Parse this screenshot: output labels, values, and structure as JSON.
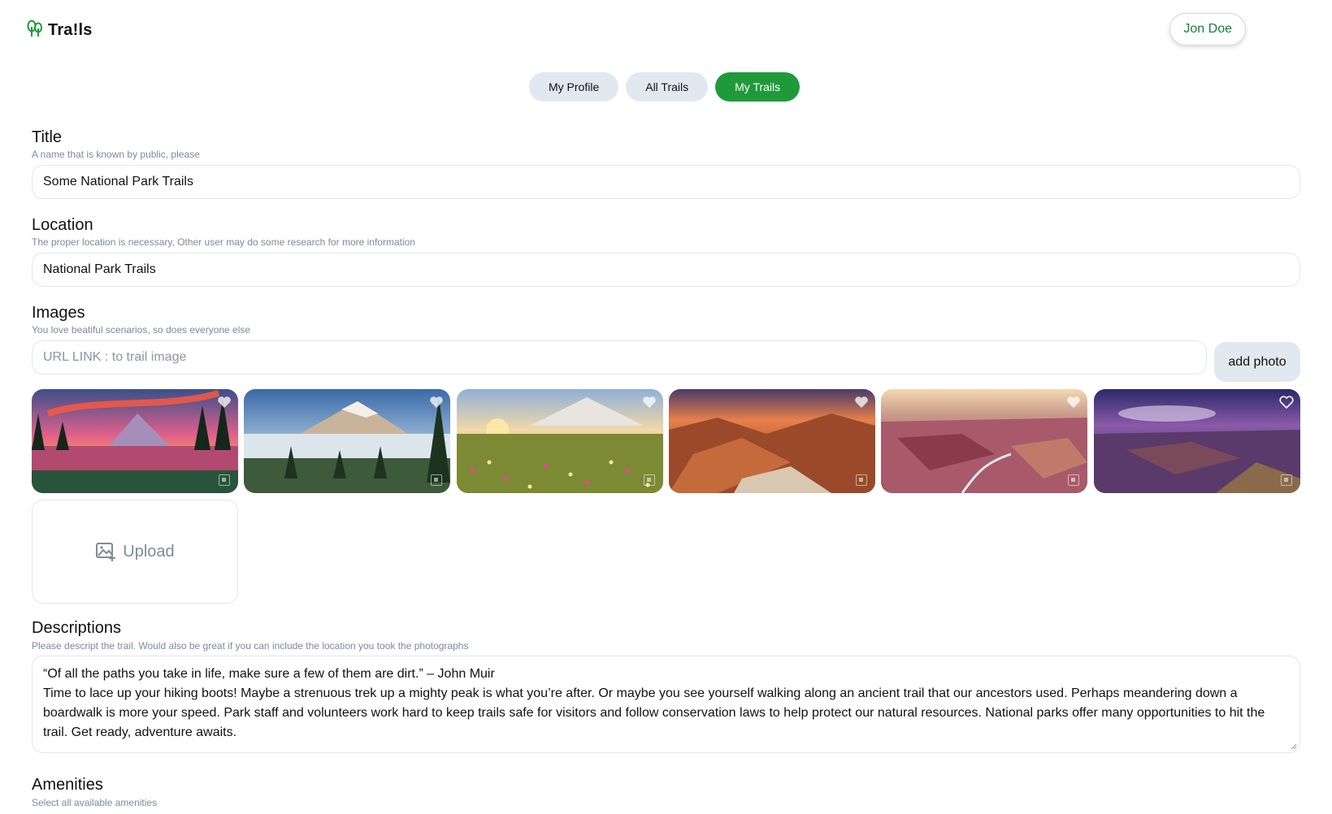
{
  "brand": {
    "name": "Tra!ls",
    "icon": "trees-icon",
    "accent": "#15803d"
  },
  "user": {
    "name": "Jon Doe"
  },
  "nav": {
    "tabs": [
      {
        "label": "My Profile",
        "active": false
      },
      {
        "label": "All Trails",
        "active": false
      },
      {
        "label": "My Trails",
        "active": true
      }
    ],
    "active_color": "#1f9a3a"
  },
  "form": {
    "title": {
      "label": "Title",
      "help": "A name that is known by public, please",
      "value": "Some National Park Trails"
    },
    "location": {
      "label": "Location",
      "help": "The proper location is necessary, Other user may do some research for more information",
      "value": "National Park Trails"
    },
    "images": {
      "label": "Images",
      "help": "You love beatiful scenarios, so does everyone else",
      "placeholder": "URL LINK : to trail image",
      "add_button": "add photo",
      "upload_label": "Upload",
      "photos": [
        {
          "scene": "mountain lake sunset",
          "favorite_icon": "heart-icon"
        },
        {
          "scene": "snow mountain above clouds",
          "favorite_icon": "heart-icon"
        },
        {
          "scene": "wildflower meadow mountain",
          "favorite_icon": "heart-icon"
        },
        {
          "scene": "canyon sunset",
          "favorite_icon": "heart-icon"
        },
        {
          "scene": "canyon river",
          "favorite_icon": "heart-icon"
        },
        {
          "scene": "canyon purple sky",
          "favorite_icon": "heart-icon"
        }
      ]
    },
    "descriptions": {
      "label": "Descriptions",
      "help": "Please descript the trail. Would also be great if you can include the location you took the photographs",
      "line1": "“Of all the paths you take in life, make sure a few of them are dirt.” – John Muir",
      "line2": "Time to lace up your hiking boots! Maybe a strenuous trek up a mighty peak is what you’re after. Or maybe you see yourself walking along an ancient trail that our ancestors used. Perhaps meandering down a boardwalk is more your speed. Park staff and volunteers work hard to keep trails safe for visitors and follow conservation laws to help protect our natural resources. National parks offer many opportunities to hit the trail. Get ready, adventure awaits."
    },
    "amenities": {
      "label": "Amenities",
      "help": "Select all available amenities"
    }
  }
}
